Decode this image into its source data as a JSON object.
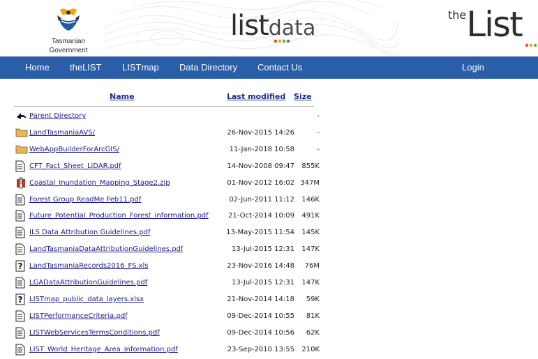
{
  "header": {
    "gov_logo_line1": "Tasmanian",
    "gov_logo_line2": "Government",
    "listdata_list": "list",
    "listdata_data": "data",
    "thelist_the": "the",
    "thelist_list": "List"
  },
  "colors": {
    "nav_bg": "#2a5ea8",
    "link": "#1a1a8e",
    "header_link": "#1a2f8e",
    "dots": [
      "#e8452b",
      "#f4a11b",
      "#5bb443",
      "#2a78c5"
    ]
  },
  "nav": {
    "items": [
      "Home",
      "theLIST",
      "LISTmap",
      "Data Directory",
      "Contact Us"
    ],
    "login": "Login"
  },
  "table": {
    "headers": {
      "name": "Name",
      "modified": "Last modified",
      "size": "Size"
    },
    "rows": [
      {
        "icon": "back-icon",
        "name": "Parent Directory",
        "modified": "",
        "size": "-"
      },
      {
        "icon": "folder-icon",
        "name": "LandTasmaniaAVS/",
        "modified": "26-Nov-2015 14:26",
        "size": "-"
      },
      {
        "icon": "folder-icon",
        "name": "WebAppBuilderForArcGIS/",
        "modified": "11-Jan-2018 10:58",
        "size": "-"
      },
      {
        "icon": "document-icon",
        "name": "CFT_Fact_Sheet_LiDAR.pdf",
        "modified": "14-Nov-2008 09:47",
        "size": "855K"
      },
      {
        "icon": "archive-icon",
        "name": "Coastal_Inundation_Mapping_Stage2.zip",
        "modified": "01-Nov-2012 16:02",
        "size": "347M"
      },
      {
        "icon": "document-icon",
        "name": "Forest Group ReadMe Feb11.pdf",
        "modified": "02-Jun-2011 11:12",
        "size": "146K"
      },
      {
        "icon": "document-icon",
        "name": "Future_Potential_Production_Forest_information.pdf",
        "modified": "21-Oct-2014 10:09",
        "size": "491K"
      },
      {
        "icon": "document-icon",
        "name": "ILS Data Attribution Guidelines.pdf",
        "modified": "13-May-2015 11:54",
        "size": "145K"
      },
      {
        "icon": "document-icon",
        "name": "LandTasmaniaDataAttributionGuidelines.pdf",
        "modified": "13-Jul-2015 12:31",
        "size": "147K"
      },
      {
        "icon": "unknown-file-icon",
        "name": "LandTasmaniaRecords2016_FS.xls",
        "modified": "23-Nov-2016 14:48",
        "size": "76M"
      },
      {
        "icon": "document-icon",
        "name": "LGADataAttributionGuidelines.pdf",
        "modified": "13-Jul-2015 12:31",
        "size": "147K"
      },
      {
        "icon": "unknown-file-icon",
        "name": "LISTmap_public_data_layers.xlsx",
        "modified": "21-Nov-2014 14:18",
        "size": "59K"
      },
      {
        "icon": "document-icon",
        "name": "LISTPerformanceCriteria.pdf",
        "modified": "09-Dec-2014 10:55",
        "size": "81K"
      },
      {
        "icon": "document-icon",
        "name": "LISTWebServicesTermsConditions.pdf",
        "modified": "09-Dec-2014 10:56",
        "size": "62K"
      },
      {
        "icon": "document-icon",
        "name": "LIST_World_Heritage_Area_information.pdf",
        "modified": "23-Sep-2010 13:55",
        "size": "210K"
      }
    ]
  }
}
